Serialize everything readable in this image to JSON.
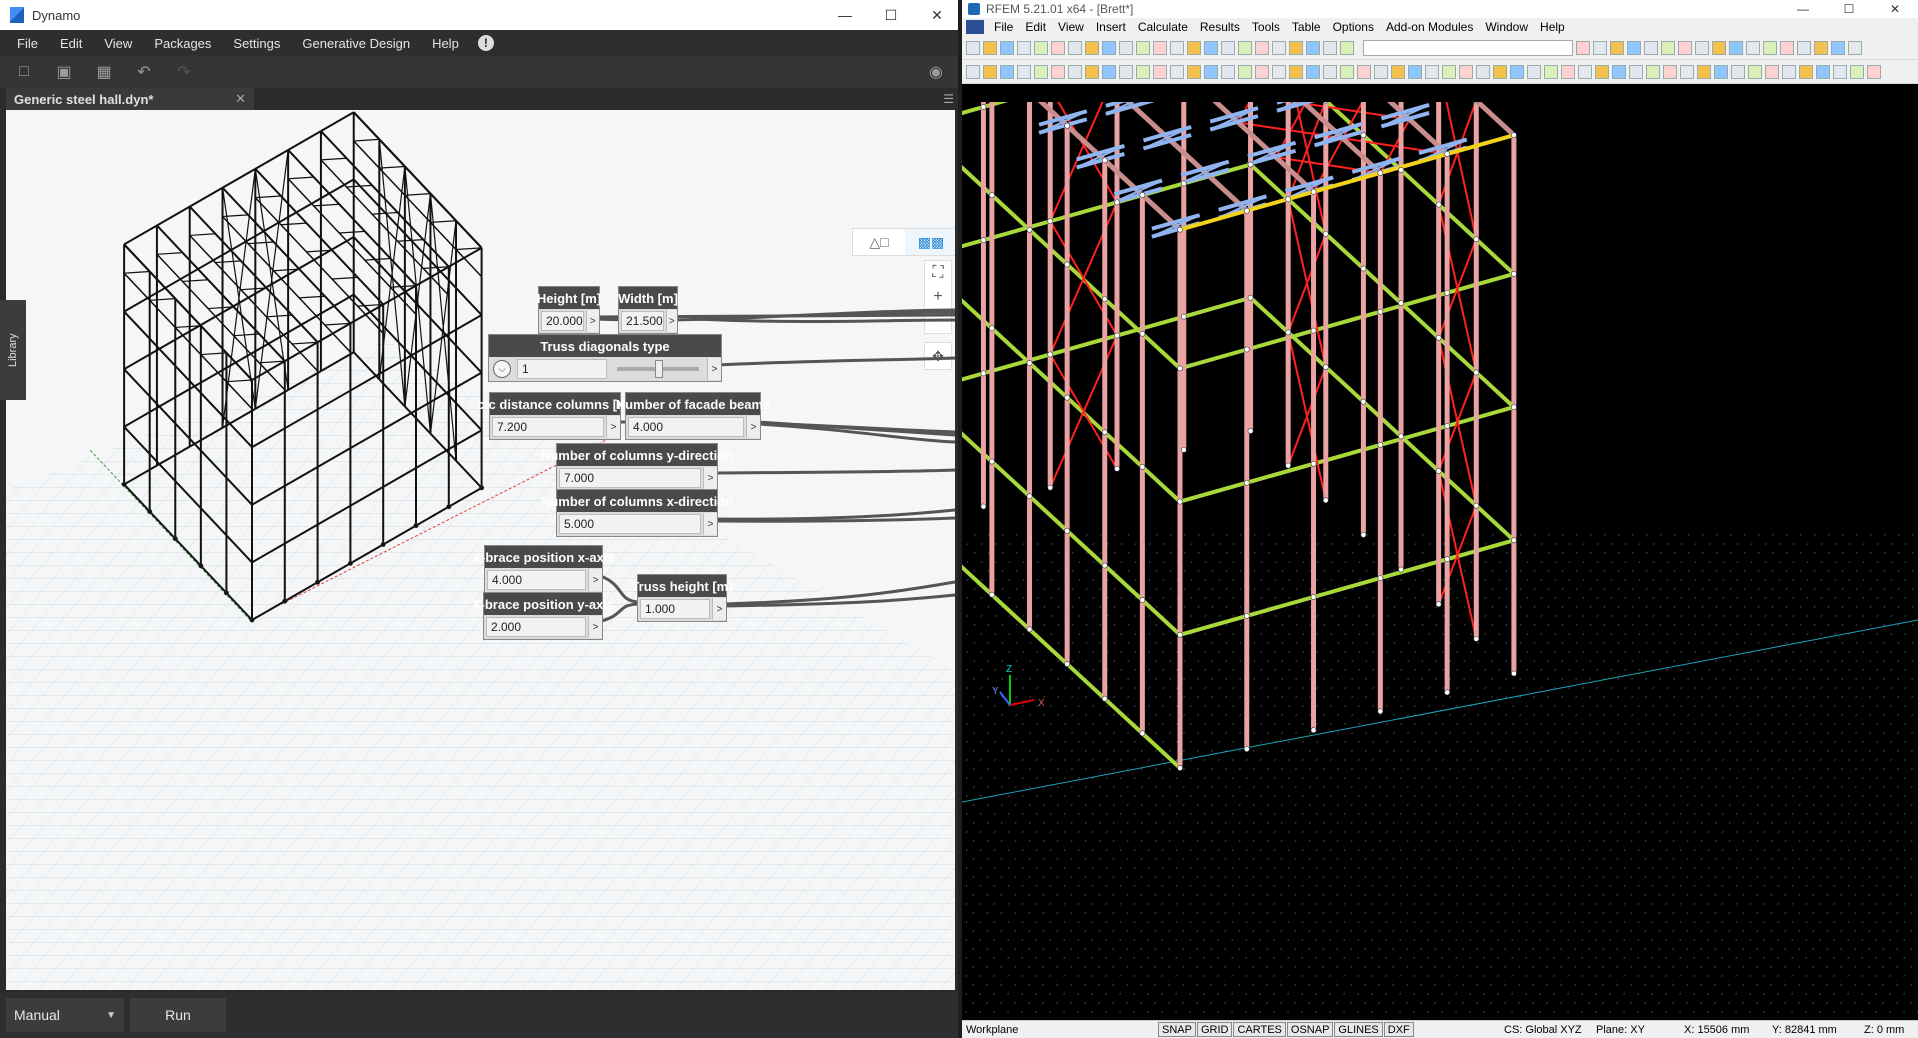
{
  "dynamo": {
    "title": "Dynamo",
    "menu": [
      "File",
      "Edit",
      "View",
      "Packages",
      "Settings",
      "Generative Design",
      "Help"
    ],
    "tab": "Generic steel hall.dyn*",
    "library_label": "Library",
    "run_mode": "Manual",
    "run_label": "Run",
    "nodes": {
      "height": {
        "label": "Height [m]",
        "value": "20.000"
      },
      "width": {
        "label": "Width [m]",
        "value": "21.500"
      },
      "truss_type": {
        "label": "Truss diagonals type",
        "value": "1"
      },
      "ctc": {
        "label": "ctc distance columns [m]",
        "value": "7.200"
      },
      "facade": {
        "label": "Number of facade beams",
        "value": "4.000"
      },
      "cols_y": {
        "label": "Number of columns y-direction",
        "value": "7.000"
      },
      "cols_x": {
        "label": "Number of columns x-direction",
        "value": "5.000"
      },
      "xbrace_x": {
        "label": "X-brace position x-axis",
        "value": "4.000"
      },
      "xbrace_y": {
        "label": "X-brace position y-axis",
        "value": "2.000"
      },
      "truss_h": {
        "label": "Truss height [m]",
        "value": "1.000"
      }
    },
    "port_glyph": ">"
  },
  "rfem": {
    "title": "RFEM 5.21.01 x64 - [Brett*]",
    "menu": [
      "File",
      "Edit",
      "View",
      "Insert",
      "Calculate",
      "Results",
      "Tools",
      "Table",
      "Options",
      "Add-on Modules",
      "Window",
      "Help"
    ],
    "status": {
      "workplane": "Workplane",
      "toggles": [
        "SNAP",
        "GRID",
        "CARTES",
        "OSNAP",
        "GLINES",
        "DXF"
      ],
      "cs": "CS: Global XYZ",
      "plane": "Plane: XY",
      "x": "X: 15506 mm",
      "y": "Y: 82841 mm",
      "z": "Z: 0 mm"
    },
    "axis_labels": {
      "z": "Z",
      "x": "X",
      "y": "Y"
    },
    "colors": {
      "column": "#e9a3a3",
      "beam": "#a8d83a",
      "truss": "#8fb4f0",
      "brace": "#ff2020",
      "ridge": "#f2d21a",
      "rafter": "#c98d8d"
    }
  }
}
